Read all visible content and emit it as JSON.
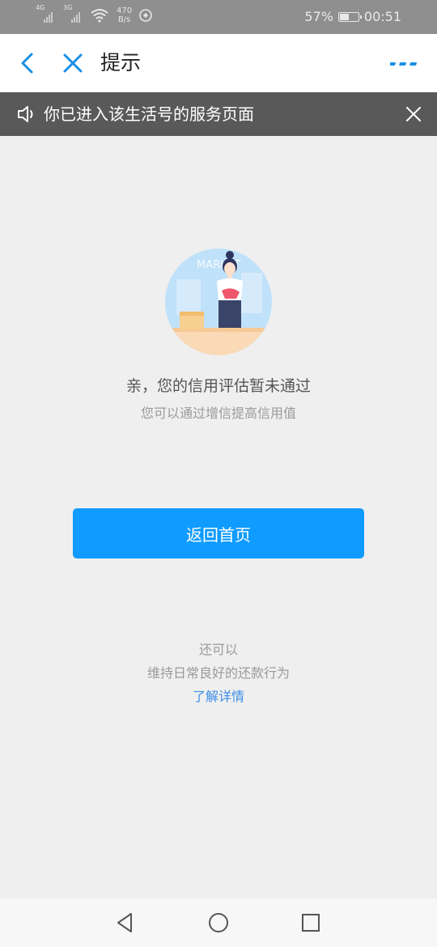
{
  "status_bar": {
    "signal1_label": "4G",
    "signal2_label": "3G",
    "speed_value": "470",
    "speed_unit": "B/s",
    "battery": "57%",
    "battery_level": 0.57,
    "time": "00:51"
  },
  "titlebar": {
    "title": "提示",
    "back_icon": "chevron-left-icon",
    "close_icon": "close-icon",
    "more_icon": "more-dots-icon"
  },
  "notice": {
    "text": "你已进入该生活号的服务页面",
    "icon": "speaker-icon"
  },
  "illustration": {
    "sign_text": "MARKET"
  },
  "message": {
    "title": "亲，您的信用评估暂未通过",
    "subtitle": "您可以通过增信提高信用值"
  },
  "actions": {
    "home_button": "返回首页"
  },
  "footer": {
    "line1": "还可以",
    "line2": "维持日常良好的还款行为",
    "link": "了解详情"
  },
  "colors": {
    "accent": "#0f9bff",
    "link": "#3a8ee6",
    "title_icon": "#1a8fe6",
    "notice_bg": "#595959",
    "page_bg": "#efefef"
  }
}
